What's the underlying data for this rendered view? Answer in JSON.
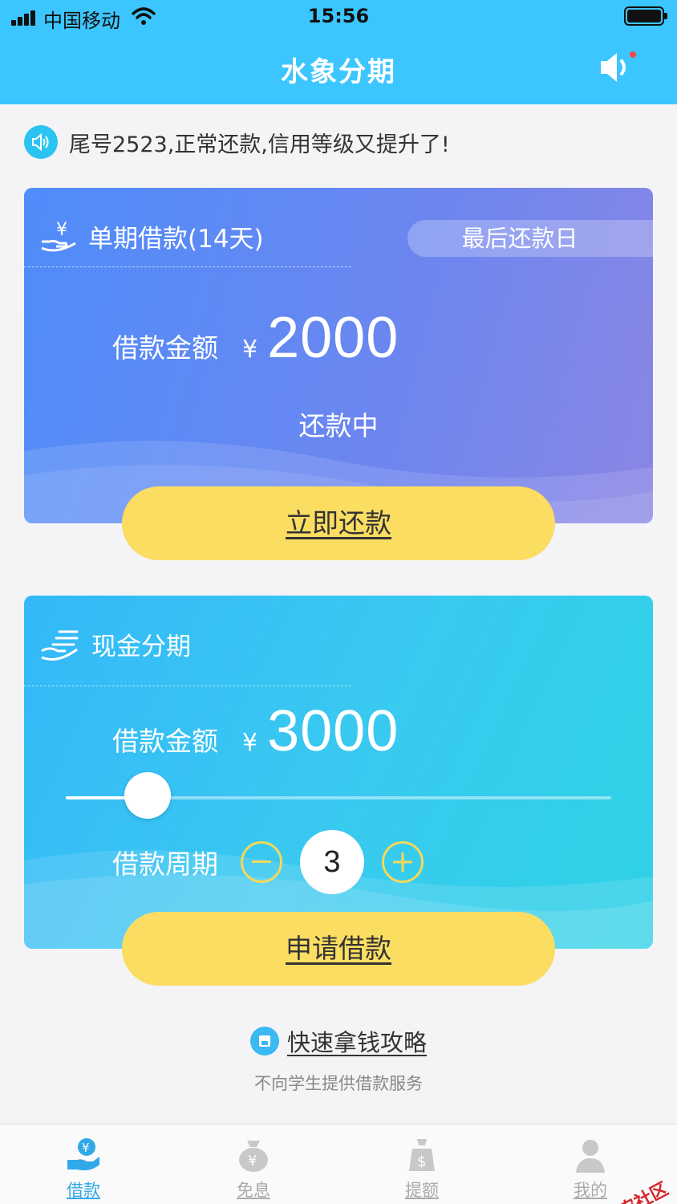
{
  "status_bar": {
    "carrier": "中国移动",
    "time": "15:56"
  },
  "header": {
    "title": "水象分期"
  },
  "notice": {
    "text": "尾号2523,正常还款,信用等级又提升了!"
  },
  "single_loan": {
    "title": "单期借款(14天)",
    "due_label": "最后还款日",
    "amount_label": "借款金额",
    "currency": "¥",
    "amount": "2000",
    "status": "还款中",
    "button": "立即还款"
  },
  "installment": {
    "title": "现金分期",
    "amount_label": "借款金额",
    "currency": "¥",
    "amount": "3000",
    "slider_fraction": 0.15,
    "period_label": "借款周期",
    "period_value": "3",
    "button": "申请借款"
  },
  "guide": {
    "text": "快速拿钱攻略"
  },
  "disclaimer": "不向学生提供借款服务",
  "tabs": [
    {
      "label": "借款",
      "icon": "loan-icon",
      "active": true
    },
    {
      "label": "免息",
      "icon": "money-bag-icon",
      "active": false
    },
    {
      "label": "提额",
      "icon": "dollar-bag-icon",
      "active": false
    },
    {
      "label": "我的",
      "icon": "user-icon",
      "active": false
    }
  ],
  "watermark": "卡农社区",
  "colors": {
    "header": "#3cc6ff",
    "button_yellow": "#fbdd62",
    "tab_active": "#31a9e8"
  }
}
